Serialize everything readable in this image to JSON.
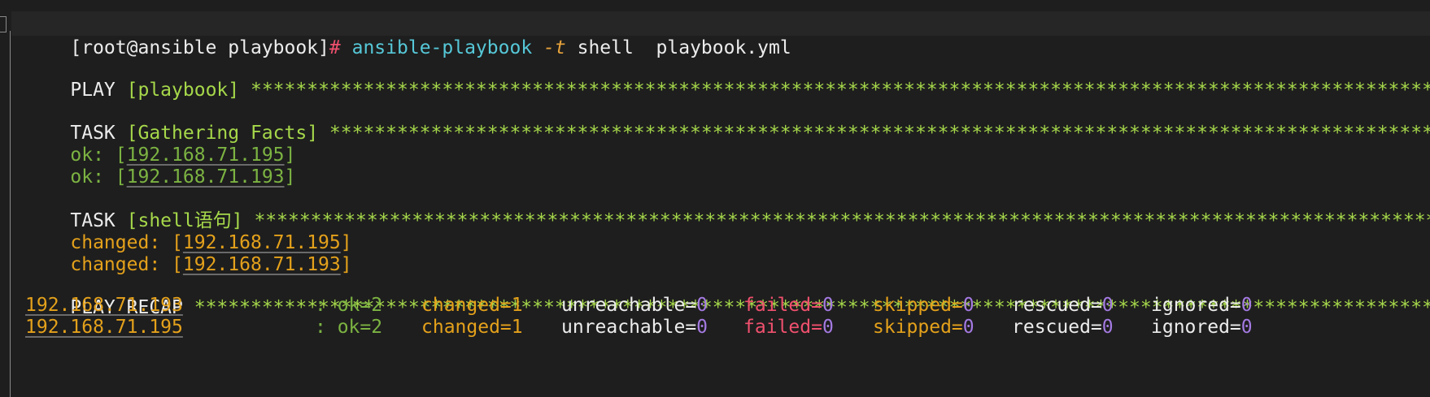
{
  "prompt": {
    "open": "[root@ansible playbook]",
    "hash": "#",
    "command": "ansible-playbook",
    "flag": "-t",
    "args": "shell  playbook.yml"
  },
  "play": {
    "keyword": "PLAY",
    "name": "[playbook]",
    "stars": "*************************************************************************************************************************************************************************************************"
  },
  "task_facts": {
    "keyword": "TASK",
    "name": "[Gathering Facts]",
    "stars": "**************************************************************************************************************************************************************",
    "results": [
      {
        "status": "ok:",
        "open": "[",
        "host": "192.168.71.195",
        "close": "]"
      },
      {
        "status": "ok:",
        "open": "[",
        "host": "192.168.71.193",
        "close": "]"
      }
    ]
  },
  "task_shell": {
    "keyword": "TASK",
    "name": "[shell语句]",
    "stars": "*********************************************************************************************************************************************************************",
    "results": [
      {
        "status": "changed:",
        "open": "[",
        "host": "192.168.71.195",
        "close": "]"
      },
      {
        "status": "changed:",
        "open": "[",
        "host": "192.168.71.193",
        "close": "]"
      }
    ]
  },
  "recap": {
    "title": "PLAY RECAP",
    "stars": "*************************************************************************************************************************************************************************************************",
    "rows": [
      {
        "host": "192.168.71.193",
        "sep": ": ok=2",
        "changed_label": "changed=1",
        "unreachable_label": "unreachable=",
        "unreachable": "0",
        "failed_label": "failed=",
        "failed": "0",
        "skipped_label": "skipped=",
        "skipped": "0",
        "rescued_label": "rescued=",
        "rescued": "0",
        "ignored_label": "ignored=",
        "ignored": "0"
      },
      {
        "host": "192.168.71.195",
        "sep": ": ok=2",
        "changed_label": "changed=1",
        "unreachable_label": "unreachable=",
        "unreachable": "0",
        "failed_label": "failed=",
        "failed": "0",
        "skipped_label": "skipped=",
        "skipped": "0",
        "rescued_label": "rescued=",
        "rescued": "0",
        "ignored_label": "ignored=",
        "ignored": "0"
      }
    ]
  },
  "colors": {
    "background": "#1e1e1e",
    "command": "#56c8d8",
    "ok": "#7cb342",
    "changed": "#e4a11b",
    "failed": "#f0506e",
    "zero": "#a47ae2",
    "stars": "#a6d84a"
  }
}
